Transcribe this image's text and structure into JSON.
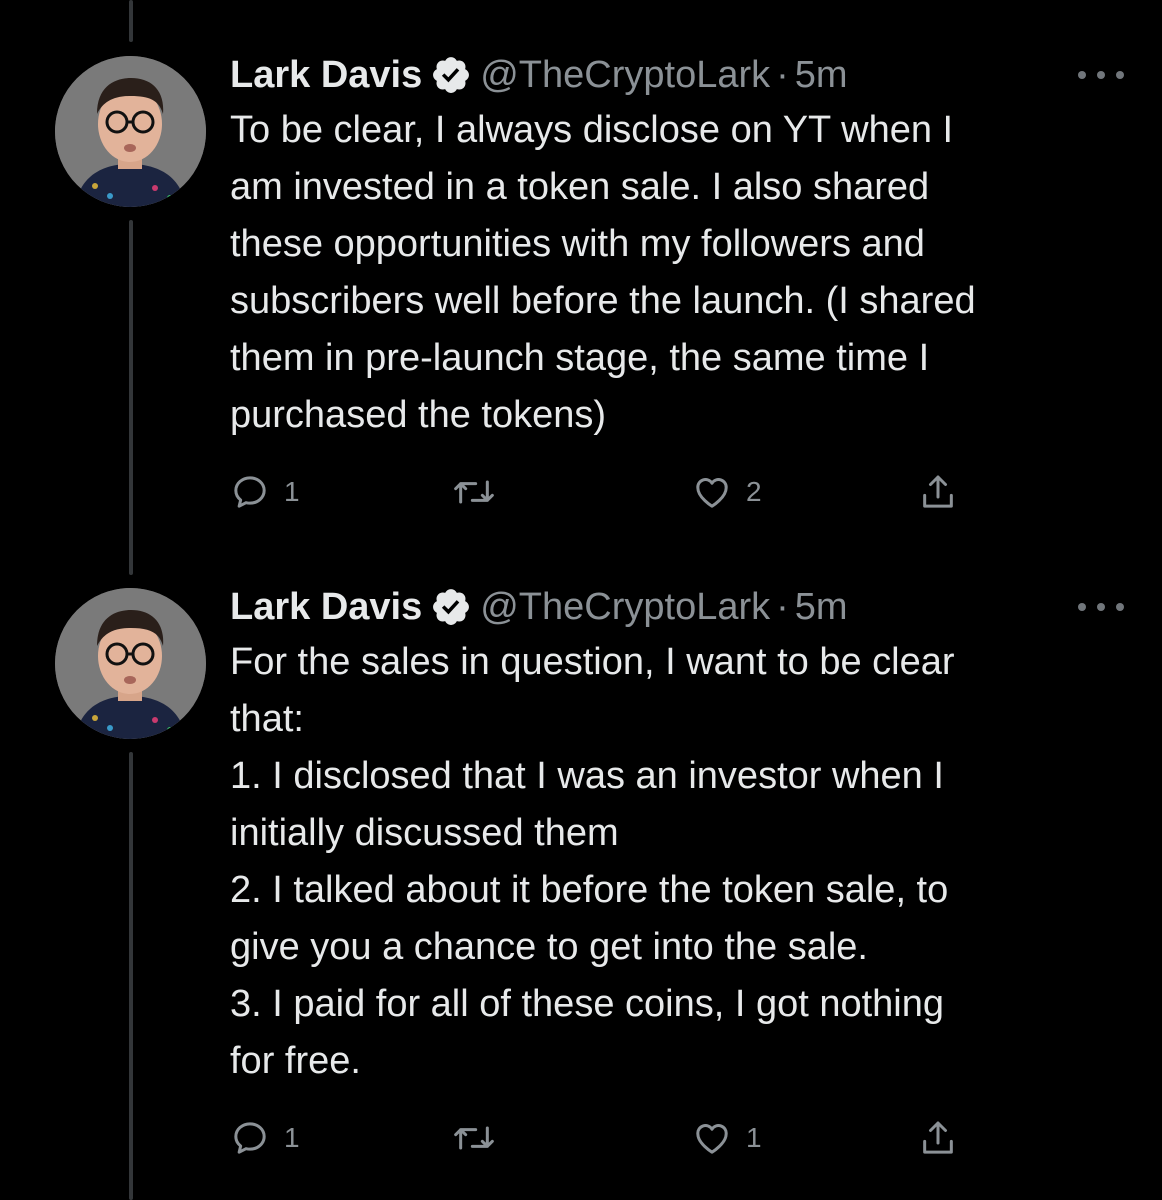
{
  "tweets": [
    {
      "author": {
        "name": "Lark Davis",
        "handle": "@TheCryptoLark",
        "verified": true,
        "avatar_icon": "profile-photo"
      },
      "separator": "·",
      "time": "5m",
      "text": "To be clear, I always disclose on YT when I\nam invested in a token sale. I also shared\nthese opportunities with my followers and\nsubscribers well before the launch. (I shared\nthem in pre-launch stage, the same time I\npurchased the tokens)",
      "actions": {
        "reply_count": "1",
        "retweet_count": "",
        "like_count": "2",
        "share_icon": "share-icon"
      }
    },
    {
      "author": {
        "name": "Lark Davis",
        "handle": "@TheCryptoLark",
        "verified": true,
        "avatar_icon": "profile-photo"
      },
      "separator": "·",
      "time": "5m",
      "text": "For the sales in question, I want to be clear\nthat:\n1. I disclosed that I was an investor when I\ninitially discussed them\n2. I talked about it before the token sale, to\ngive you a chance to get into the sale.\n3. I paid for all of these coins, I got nothing\nfor free.",
      "actions": {
        "reply_count": "1",
        "retweet_count": "",
        "like_count": "1",
        "share_icon": "share-icon"
      }
    }
  ],
  "colors": {
    "background": "#000000",
    "text": "#e7e9ea",
    "secondary": "#8b9196",
    "thread_line": "#333639",
    "verified_badge": "#e7e9ea"
  }
}
